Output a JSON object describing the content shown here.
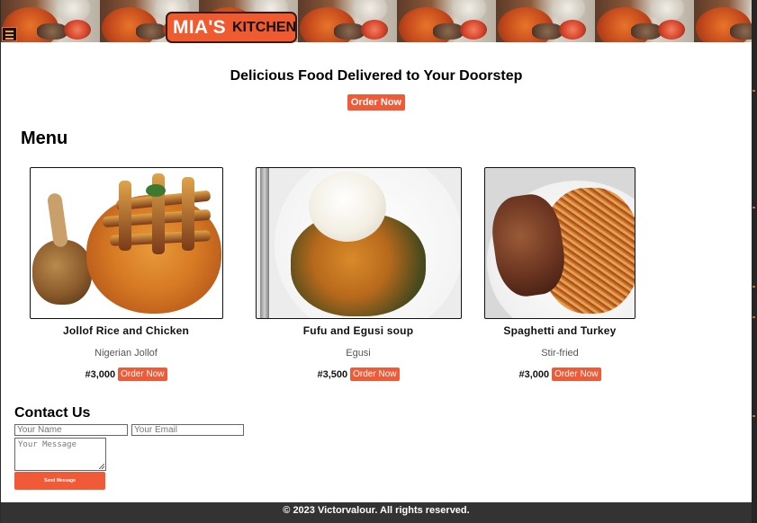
{
  "header": {
    "logo_main": "MIA'S",
    "logo_sub": "KITCHEN",
    "menu_icon": "hamburger-icon"
  },
  "hero": {
    "title": "Delicious Food Delivered to Your Doorstep",
    "cta": "Order Now"
  },
  "menu": {
    "title": "Menu",
    "items": [
      {
        "name": "Jollof Rice and Chicken",
        "desc": "Nigerian Jollof",
        "price": "#3,000",
        "order": "Order Now"
      },
      {
        "name": "Fufu and Egusi soup",
        "desc": "Egusi",
        "price": "#3,500",
        "order": "Order Now"
      },
      {
        "name": "Spaghetti and Turkey",
        "desc": "Stir-fried",
        "price": "#3,000",
        "order": "Order Now"
      }
    ]
  },
  "contact": {
    "title": "Contact Us",
    "name_placeholder": "Your Name",
    "email_placeholder": "Your Email",
    "message_placeholder": "Your Message",
    "send": "Send Message"
  },
  "footer": {
    "text": "© 2023 Victorvalour. All rights reserved."
  },
  "colors": {
    "accent": "#f15a37",
    "footer_bg": "#333333"
  }
}
